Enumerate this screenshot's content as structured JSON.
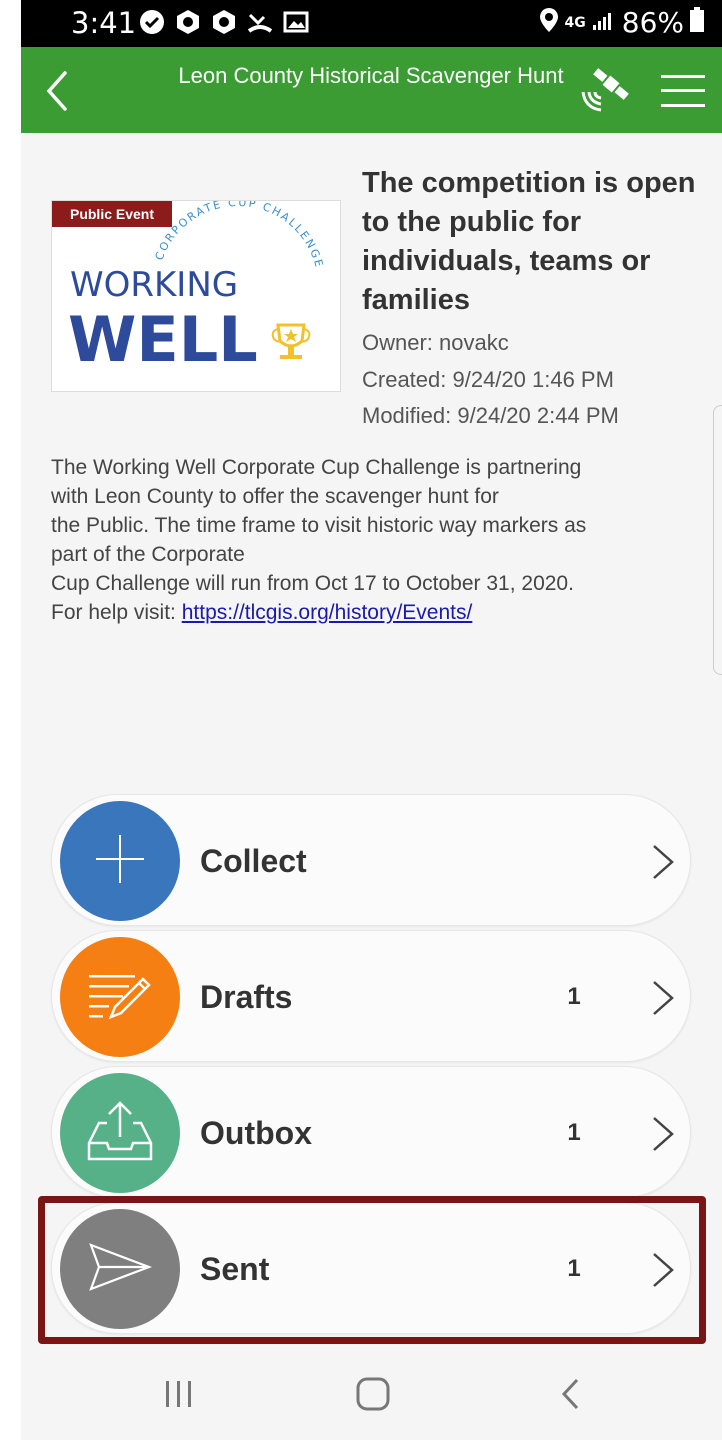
{
  "status_bar": {
    "time": "3:41",
    "network": "4G",
    "battery": "86%"
  },
  "header": {
    "title": "Leon County Historical Scavenger Hunt",
    "back_icon": "chevron-left-icon",
    "gps_icon": "satellite-gps-icon",
    "menu_icon": "hamburger-menu-icon",
    "color": "#3b9c33"
  },
  "thumbnail": {
    "badge": "Public Event",
    "logo_top_arc": "CORPORATE CUP CHALLENGE",
    "logo_line1": "WORKING",
    "logo_line2": "WELL"
  },
  "item": {
    "title": "The competition is open to the public for individuals, teams or families",
    "owner": "Owner: novakc",
    "created": "Created: 9/24/20 1:46 PM",
    "modified": "Modified: 9/24/20 2:44 PM"
  },
  "description": {
    "lines": [
      "The Working Well Corporate Cup Challenge is partnering",
      "with Leon County to offer the scavenger hunt for",
      "the Public. The time frame to visit historic way markers as",
      "part of the Corporate",
      "Cup Challenge will run from Oct 17 to October 31, 2020."
    ],
    "help_prefix": "For help visit: ",
    "help_link": "https://tlcgis.org/history/Events/"
  },
  "actions": [
    {
      "label": "Collect",
      "count": "",
      "color": "#3a76bb",
      "icon": "plus-icon"
    },
    {
      "label": "Drafts",
      "count": "1",
      "color": "#f57f12",
      "icon": "pencil-notes-icon"
    },
    {
      "label": "Outbox",
      "count": "1",
      "color": "#56b188",
      "icon": "outbox-upload-icon"
    },
    {
      "label": "Sent",
      "count": "1",
      "color": "#7f7f7f",
      "icon": "paper-plane-icon"
    }
  ],
  "highlight_color": "#7a1516",
  "nav": {
    "recent_icon": "recent-apps-icon",
    "home_icon": "home-icon",
    "back_icon": "back-icon"
  }
}
